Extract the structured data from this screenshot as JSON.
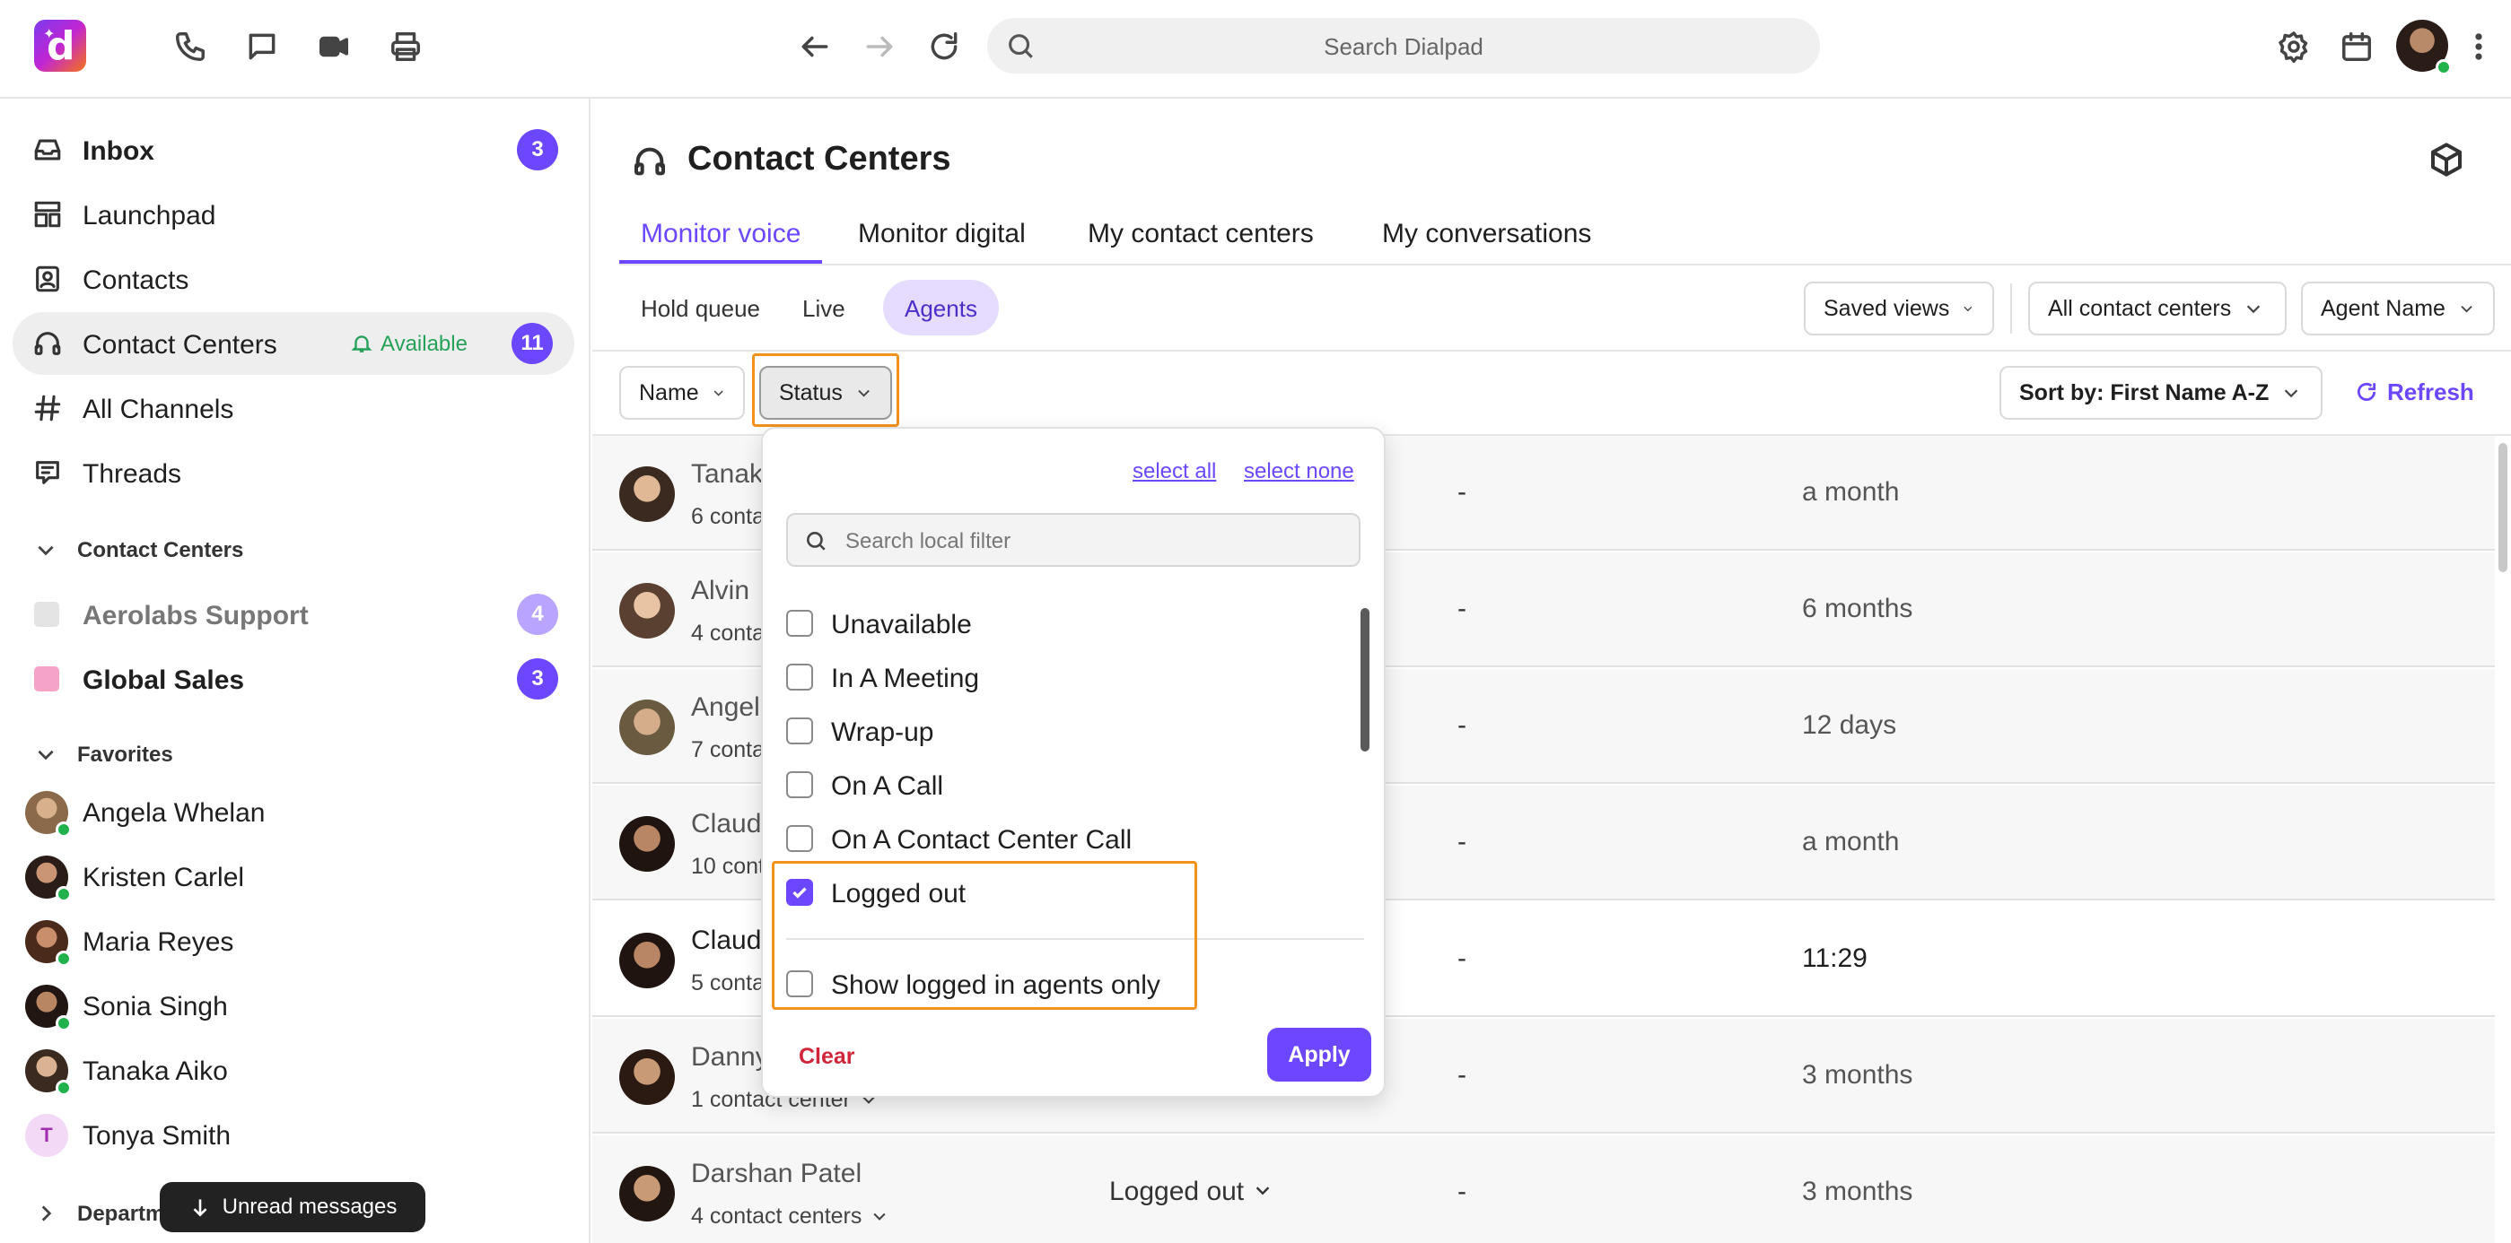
{
  "topbar": {
    "search_placeholder": "Search Dialpad",
    "icons": [
      "phone-icon",
      "chat-icon",
      "video-icon",
      "printer-icon",
      "back-arrow-icon",
      "forward-arrow-icon",
      "reload-icon",
      "search-icon",
      "gear-icon",
      "calendar-icon",
      "more-vertical-icon"
    ]
  },
  "sidebar": {
    "items": [
      {
        "label": "Inbox",
        "badge": "3"
      },
      {
        "label": "Launchpad"
      },
      {
        "label": "Contacts"
      },
      {
        "label": "Contact Centers",
        "status": "Available",
        "badge": "11"
      },
      {
        "label": "All Channels"
      },
      {
        "label": "Threads"
      }
    ],
    "contact_centers_header": "Contact Centers",
    "contact_centers": [
      {
        "label": "Aerolabs Support",
        "badge": "4",
        "color": "#e4e4e4"
      },
      {
        "label": "Global Sales",
        "badge": "3",
        "color": "#f5a3c7"
      }
    ],
    "favorites_header": "Favorites",
    "favorites": [
      {
        "name": "Angela Whelan"
      },
      {
        "name": "Kristen Carlel"
      },
      {
        "name": "Maria Reyes"
      },
      {
        "name": "Sonia Singh"
      },
      {
        "name": "Tanaka Aiko"
      },
      {
        "name": "Tonya Smith",
        "initial": "T"
      }
    ],
    "departments_header": "Departm",
    "unread_label": "Unread messages"
  },
  "main": {
    "title": "Contact Centers",
    "tabs": [
      "Monitor voice",
      "Monitor digital",
      "My contact centers",
      "My conversations"
    ],
    "subtabs": [
      "Hold queue",
      "Live",
      "Agents"
    ],
    "saved_views": "Saved views",
    "all_contact_centers": "All contact centers",
    "agent_name": "Agent Name",
    "filter_name": "Name",
    "filter_status": "Status",
    "sort_label": "Sort by: First Name A-Z",
    "refresh_label": "Refresh",
    "rows": [
      {
        "name": "Tanak",
        "sub": "6 conta",
        "dash": "-",
        "time": "a month"
      },
      {
        "name": "Alvin",
        "sub": "4 conta",
        "dash": "-",
        "time": "6 months"
      },
      {
        "name": "Angel",
        "sub": "7 conta",
        "dash": "-",
        "time": "12 days"
      },
      {
        "name": "Claud",
        "sub": "10 cont",
        "dash": "-",
        "time": "a month"
      },
      {
        "name": "Claud",
        "sub": "5 conta",
        "dash": "-",
        "time": "11:29"
      },
      {
        "name": "Danny",
        "sub": "1 contact center",
        "dash": "-",
        "time": "3 months"
      },
      {
        "name": "Darshan Patel",
        "sub": "4 contact centers",
        "status": "Logged out",
        "dash": "-",
        "time": "3 months"
      }
    ]
  },
  "status_panel": {
    "select_all": "select all",
    "select_none": "select none",
    "search_placeholder": "Search local filter",
    "options": [
      {
        "label": "Unavailable",
        "checked": false
      },
      {
        "label": "In A Meeting",
        "checked": false
      },
      {
        "label": "Wrap-up",
        "checked": false
      },
      {
        "label": "On A Call",
        "checked": false
      },
      {
        "label": "On A Contact Center Call",
        "checked": false
      },
      {
        "label": "Logged out",
        "checked": true
      }
    ],
    "logged_in_only": {
      "label": "Show logged in agents only",
      "checked": false
    },
    "clear_label": "Clear",
    "apply_label": "Apply"
  },
  "colors": {
    "accent": "#6c47ff",
    "highlight": "#f2921d",
    "available": "#26a159",
    "danger": "#d0253a"
  }
}
